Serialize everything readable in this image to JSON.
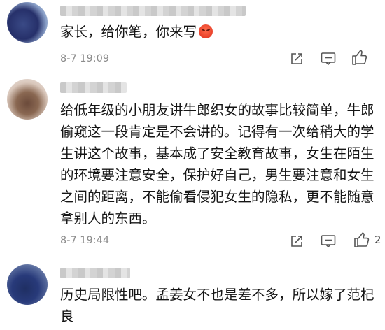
{
  "comments": [
    {
      "text": "家长，给你笔，你来写",
      "emoji": "angry-face",
      "time": "8-7 19:09",
      "likes": ""
    },
    {
      "text": "给低年级的小朋友讲牛郎织女的故事比较简单，牛郎偷窥这一段肯定是不会讲的。记得有一次给稍大的学生讲这个故事，基本成了安全教育故事，女生在陌生的环境要注意安全，保护好自己，男生要注意和女生之间的距离，不能偷看侵犯女生的隐私，更不能随意拿别人的东西。",
      "time": "8-7 19:44",
      "likes": "2"
    },
    {
      "text": "历史局限性吧。孟姜女不也是差不多，所以嫁了范杞良",
      "time": "",
      "likes": ""
    }
  ],
  "icons": {
    "share": "share-icon",
    "reply": "comment-icon",
    "like": "thumbs-up-icon"
  }
}
